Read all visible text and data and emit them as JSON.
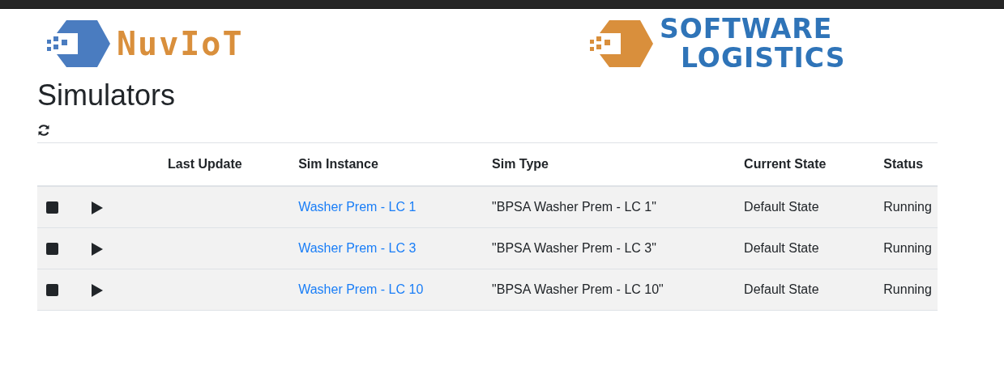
{
  "logos": [
    {
      "kind": "nuviot",
      "text": "NuvIoT"
    },
    {
      "kind": "softwarelogistics",
      "lines": [
        "SOFTWARE",
        "LOGISTICS"
      ]
    }
  ],
  "page_title": "Simulators",
  "table": {
    "columns": [
      "Last Update",
      "Sim Instance",
      "Sim Type",
      "Current State",
      "Status"
    ],
    "rows": [
      {
        "sim_instance": "Washer Prem - LC 1",
        "sim_type": "\"BPSA Washer Prem - LC 1\"",
        "current_state": "Default State",
        "status": "Running"
      },
      {
        "sim_instance": "Washer Prem - LC 3",
        "sim_type": "\"BPSA Washer Prem - LC 3\"",
        "current_state": "Default State",
        "status": "Running"
      },
      {
        "sim_instance": "Washer Prem - LC 10",
        "sim_type": "\"BPSA Washer Prem - LC 10\"",
        "current_state": "Default State",
        "status": "Running"
      }
    ]
  }
}
